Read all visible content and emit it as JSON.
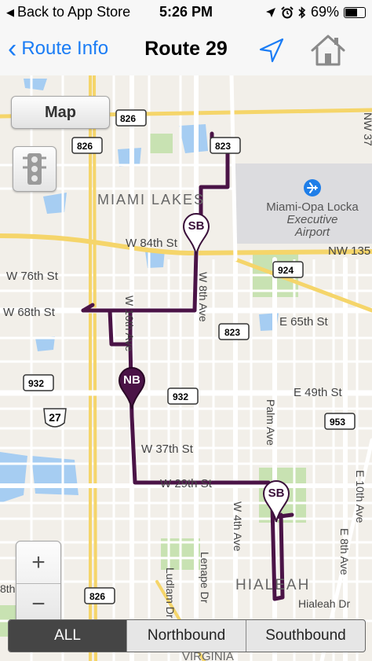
{
  "status_bar": {
    "back_label": "Back to App Store",
    "time": "5:26 PM",
    "battery": "69%",
    "battery_level": 0.69
  },
  "nav": {
    "back_label": "Route Info",
    "title": "Route 29"
  },
  "map": {
    "map_type_label": "Map",
    "zoom_in_label": "+",
    "zoom_out_label": "−",
    "route_color": "#4a1346",
    "labels": {
      "miami_lakes": "MIAMI LAKES",
      "airport": "Miami-Opa Locka Executive Airport",
      "w84": "W 84th St",
      "nw135": "NW 135",
      "w76": "W 76th St",
      "w68": "W 68th St",
      "e65": "E 65th St",
      "e49": "E 49th St",
      "w37": "W 37th St",
      "w29": "W 29th St",
      "w16ave": "W 16th Ave",
      "w8ave": "W 8th Ave",
      "palm": "Palm Ave",
      "w4ave": "W 4th Ave",
      "e8ave": "E 8th Ave",
      "e10ave": "E 10th Ave",
      "lenape": "Lenape Dr",
      "ludlam": "Ludlam Dr",
      "hialeah": "HIALEAH",
      "hialeah_dr": "Hialeah Dr",
      "virginia": "VIRGINIA",
      "nw37": "NW 37",
      "left_8th": "8th"
    },
    "shields": {
      "s826a": "826",
      "s826b": "826",
      "s823a": "823",
      "s924": "924",
      "s823b": "823",
      "s932a": "932",
      "s932b": "932",
      "s27": "27",
      "s953": "953",
      "s826c": "826"
    },
    "pins": {
      "sb_top": "SB",
      "nb": "NB",
      "sb_bottom": "SB"
    }
  },
  "segments": [
    {
      "label": "ALL",
      "active": true
    },
    {
      "label": "Northbound",
      "active": false
    },
    {
      "label": "Southbound",
      "active": false
    }
  ]
}
